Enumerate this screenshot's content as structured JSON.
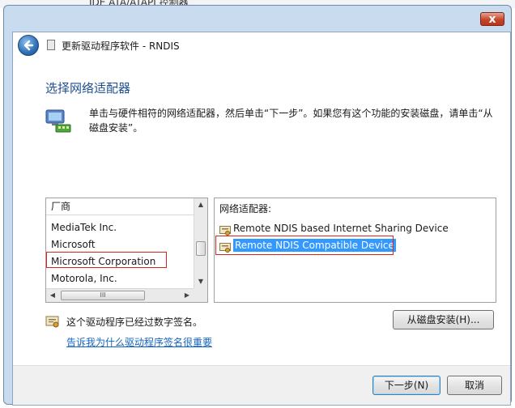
{
  "background_window": {
    "title": "IDE ATA/ATAPI 控制器"
  },
  "window": {
    "close_label": "x",
    "title": "更新驱动程序软件 - RNDIS"
  },
  "page": {
    "heading": "选择网络适配器",
    "instruction": "单击与硬件相符的网络适配器，然后单击“下一步”。如果您有这个功能的安装磁盘，请单击“从磁盘安装”。"
  },
  "manufacturer_list": {
    "header": "厂商",
    "items": [
      "MediaTek Inc.",
      "Microsoft",
      "Microsoft Corporation",
      "Motorola, Inc."
    ],
    "highlighted_index": 2,
    "hscroll_grip": "III"
  },
  "adapter_list": {
    "header": "网络适配器:",
    "items": [
      "Remote NDIS based Internet Sharing Device",
      "Remote NDIS Compatible Device"
    ],
    "selected_index": 1
  },
  "signing": {
    "text": "这个驱动程序已经过数字签名。",
    "link": "告诉我为什么驱动程序签名很重要"
  },
  "buttons": {
    "have_disk": "从磁盘安装(H)...",
    "next": "下一步(N)",
    "cancel": "取消"
  },
  "colors": {
    "accent": "#3399ff",
    "highlight_border": "#d9261c",
    "heading": "#1e4f8f",
    "link": "#1565c0"
  }
}
